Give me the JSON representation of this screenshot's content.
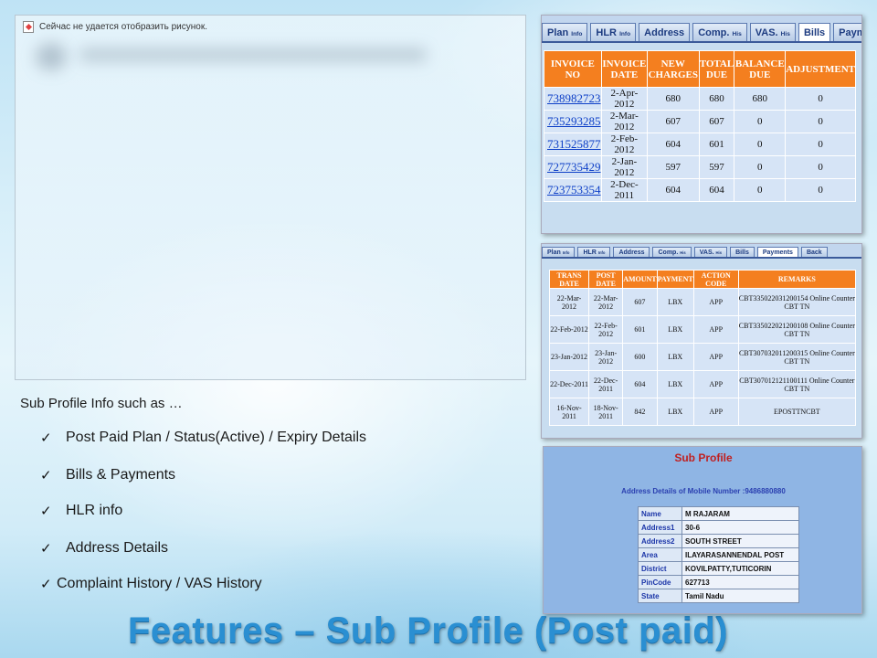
{
  "slide": {
    "title": "Features – Sub Profile (Post paid)",
    "intro": "Sub Profile Info such as …",
    "bullets": [
      "Post Paid Plan / Status(Active) / Expiry Details",
      "Bills & Payments",
      "HLR info",
      "Address Details",
      "Complaint History / VAS History"
    ],
    "check_icon": "✓"
  },
  "broken_image": {
    "message": "Сейчас не удается отобразить рисунок."
  },
  "bills_panel": {
    "tabs": [
      {
        "label": "Plan",
        "suffix": "Info"
      },
      {
        "label": "HLR",
        "suffix": "Info"
      },
      {
        "label": "Address",
        "suffix": ""
      },
      {
        "label": "Comp.",
        "suffix": "His"
      },
      {
        "label": "VAS.",
        "suffix": "His"
      },
      {
        "label": "Bills",
        "suffix": ""
      },
      {
        "label": "Payments",
        "suffix": ""
      },
      {
        "label": "Back",
        "suffix": ""
      }
    ],
    "active_tab": "Bills",
    "headers": [
      "INVOICE NO",
      "INVOICE DATE",
      "NEW CHARGES",
      "TOTAL DUE",
      "BALANCE DUE",
      "ADJUSTMENT"
    ],
    "rows": [
      [
        "738982723",
        "2-Apr-2012",
        "680",
        "680",
        "680",
        "0"
      ],
      [
        "735293285",
        "2-Mar-2012",
        "607",
        "607",
        "0",
        "0"
      ],
      [
        "731525877",
        "2-Feb-2012",
        "604",
        "601",
        "0",
        "0"
      ],
      [
        "727735429",
        "2-Jan-2012",
        "597",
        "597",
        "0",
        "0"
      ],
      [
        "723753354",
        "2-Dec-2011",
        "604",
        "604",
        "0",
        "0"
      ]
    ]
  },
  "payments_panel": {
    "tabs": [
      {
        "label": "Plan",
        "suffix": "Info"
      },
      {
        "label": "HLR",
        "suffix": "Info"
      },
      {
        "label": "Address",
        "suffix": ""
      },
      {
        "label": "Comp.",
        "suffix": "His"
      },
      {
        "label": "VAS.",
        "suffix": "His"
      },
      {
        "label": "Bills",
        "suffix": ""
      },
      {
        "label": "Payments",
        "suffix": ""
      },
      {
        "label": "Back",
        "suffix": ""
      }
    ],
    "active_tab": "Payments",
    "headers": [
      "TRANS DATE",
      "POST DATE",
      "AMOUNT",
      "PAYMENT",
      "ACTION CODE",
      "REMARKS"
    ],
    "rows": [
      [
        "22-Mar-2012",
        "22-Mar-2012",
        "607",
        "LBX",
        "APP",
        "CBT335022031200154 Online Counter CBT TN"
      ],
      [
        "22-Feb-2012",
        "22-Feb-2012",
        "601",
        "LBX",
        "APP",
        "CBT335022021200108 Online Counter CBT TN"
      ],
      [
        "23-Jan-2012",
        "23-Jan-2012",
        "600",
        "LBX",
        "APP",
        "CBT307032011200315 Online Counter CBT TN"
      ],
      [
        "22-Dec-2011",
        "22-Dec-2011",
        "604",
        "LBX",
        "APP",
        "CBT307012121100111 Online Counter CBT TN"
      ],
      [
        "16-Nov-2011",
        "18-Nov-2011",
        "842",
        "LBX",
        "APP",
        "EPOSTTNCBT"
      ]
    ]
  },
  "sub_profile_panel": {
    "title": "Sub Profile",
    "subtitle_prefix": "Address Details of Mobile Number :",
    "mobile_number": "9486880880",
    "fields": [
      {
        "key": "Name",
        "value": "M RAJARAM"
      },
      {
        "key": "Address1",
        "value": "30-6"
      },
      {
        "key": "Address2",
        "value": "SOUTH STREET"
      },
      {
        "key": "Area",
        "value": "ILAYARASANNENDAL POST"
      },
      {
        "key": "District",
        "value": "KOVILPATTY,TUTICORIN"
      },
      {
        "key": "PinCode",
        "value": "627713"
      },
      {
        "key": "State",
        "value": "Tamil Nadu"
      }
    ]
  },
  "colors": {
    "header_orange": "#f47f1f",
    "cell_blue": "#d6e4f6",
    "title_blue": "#2a8fd2",
    "link_blue": "#0d3fc7"
  }
}
